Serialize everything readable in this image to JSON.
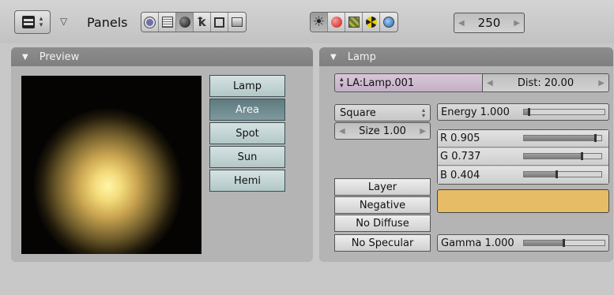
{
  "header": {
    "panels_label": "Panels",
    "frame_value": "250"
  },
  "preview": {
    "title": "Preview",
    "lamp_types": [
      "Lamp",
      "Area",
      "Spot",
      "Sun",
      "Hemi"
    ],
    "selected_type": "Area"
  },
  "lamp": {
    "title": "Lamp",
    "name": "LA:Lamp.001",
    "dist": "Dist: 20.00",
    "shape": "Square",
    "size": "Size 1.00",
    "energy": "Energy 1.000",
    "energy_value": 1.0,
    "r": "R 0.905",
    "r_value": 0.905,
    "g": "G 0.737",
    "g_value": 0.737,
    "b": "B 0.404",
    "b_value": 0.404,
    "color_hex": "#e7bc67",
    "toggles": [
      "Layer",
      "Negative",
      "No Diffuse",
      "No Specular"
    ],
    "gamma": "Gamma 1.000",
    "gamma_value": 1.0
  },
  "colors": {
    "panel_header": "#858585",
    "selected_button": "#6a868a",
    "button": "#c6d6d6"
  }
}
